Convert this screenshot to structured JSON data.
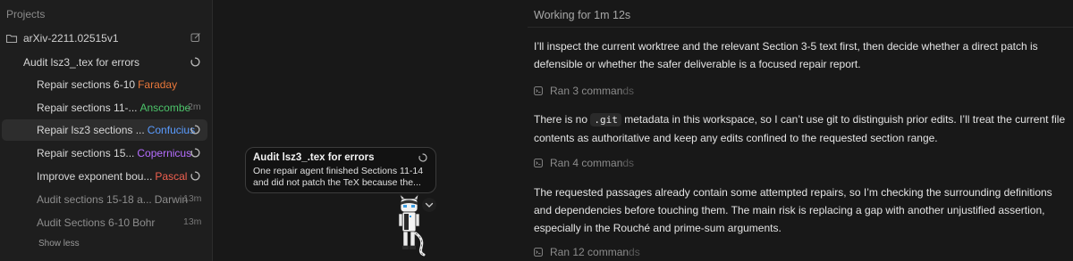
{
  "sidebar": {
    "header": "Projects",
    "project": {
      "name": "arXiv-2211.02515v1",
      "folder_icon": "folder-icon",
      "edit_icon": "edit-icon"
    },
    "items": [
      {
        "label": "Audit lsz3_.tex for errors",
        "agent": "",
        "agent_color": "",
        "status": "spinner",
        "time": ""
      },
      {
        "label": "Repair sections 6-10",
        "agent": "Faraday",
        "agent_color": "#e8773a",
        "status": "",
        "time": ""
      },
      {
        "label": "Repair sections 11-...",
        "agent": "Anscombe",
        "agent_color": "#4cc46a",
        "status": "",
        "time": "2m"
      },
      {
        "label": "Repair lsz3 sections ...",
        "agent": "Confucius",
        "agent_color": "#5a9cff",
        "status": "spinner",
        "time": ""
      },
      {
        "label": "Repair sections 15...",
        "agent": "Copernicus",
        "agent_color": "#b56dff",
        "status": "spinner",
        "time": ""
      },
      {
        "label": "Improve exponent bou...",
        "agent": "Pascal",
        "agent_color": "#f0604f",
        "status": "spinner",
        "time": ""
      },
      {
        "label": "Audit sections 15-18 a...",
        "agent": "Darwin",
        "agent_color": "#8d8d8d",
        "status": "",
        "time": "13m"
      },
      {
        "label": "Audit Sections 6-10",
        "agent": "Bohr",
        "agent_color": "#8d8d8d",
        "status": "",
        "time": "13m"
      }
    ],
    "show_less": "Show less"
  },
  "tooltip": {
    "title": "Audit lsz3_.tex for errors",
    "body": "One repair agent finished Sections 11-14 and did not patch the TeX because the..."
  },
  "main": {
    "working": "Working for 1m 12s",
    "p1": "I’ll inspect the current worktree and the relevant Section 3-5 text first, then decide whether a direct patch is defensible or whether the safer deliverable is a focused repair report.",
    "ran1_main": "Ran 3 comman",
    "ran1_fade": "ds",
    "p2_a": "There is no",
    "p2_code": ".git",
    "p2_b": "metadata in this workspace, so I can’t use git to distinguish prior edits. I’ll treat the current file contents as authoritative and keep any edits confined to the requested section range.",
    "ran2_main": "Ran 4 comman",
    "ran2_fade": "ds",
    "p3": "The requested passages already contain some attempted repairs, so I’m checking the surrounding definitions and dependencies before touching them. The main risk is replacing a gap with another unjustified assertion, especially in the Rouché and prime-sum arguments.",
    "ran3_main": "Ran 12 comman",
    "ran3_fade": "ds"
  }
}
